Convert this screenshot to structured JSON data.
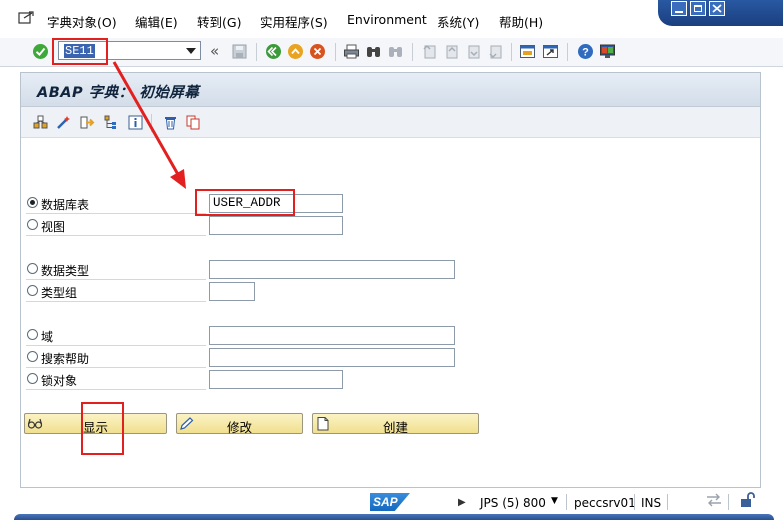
{
  "menubar": {
    "items": [
      "字典对象(O)",
      "编辑(E)",
      "转到(G)",
      "实用程序(S)",
      "Environment",
      "系统(Y)",
      "帮助(H)"
    ]
  },
  "toolbar": {
    "command_value": "SE11"
  },
  "screen": {
    "title": "ABAP 字典： 初始屏幕"
  },
  "form": {
    "options": [
      {
        "label": "数据库表",
        "selected": true,
        "value": "USER_ADDR"
      },
      {
        "label": "视图",
        "selected": false,
        "value": ""
      },
      {
        "label": "数据类型",
        "selected": false,
        "value": ""
      },
      {
        "label": "类型组",
        "selected": false,
        "value": ""
      },
      {
        "label": "域",
        "selected": false,
        "value": ""
      },
      {
        "label": "搜索帮助",
        "selected": false,
        "value": ""
      },
      {
        "label": "锁对象",
        "selected": false,
        "value": ""
      }
    ]
  },
  "buttons": {
    "display": "显示",
    "change": "修改",
    "create": "创建"
  },
  "statusbar": {
    "sap_logo": "SAP",
    "system": "JPS (5) 800",
    "server": "peccsrv01",
    "mode": "INS"
  },
  "colors": {
    "accent": "#2b5da7",
    "annotation": "#e32020",
    "button": "#f1e08f"
  }
}
